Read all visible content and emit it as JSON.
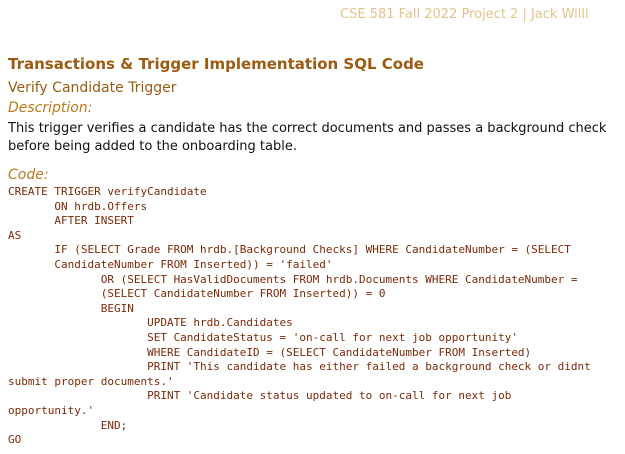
{
  "header": {
    "running_title": "CSE 581 Fall 2022 Project 2 | Jack Willi"
  },
  "section": {
    "title": "Transactions & Trigger Implementation SQL Code"
  },
  "subsection": {
    "title": "Verify Candidate Trigger"
  },
  "description": {
    "label": "Description:",
    "text": "This trigger verifies a candidate has the correct documents and passes a background check before being added to the onboarding table."
  },
  "code": {
    "label": "Code:",
    "lines": [
      "CREATE TRIGGER verifyCandidate",
      "       ON hrdb.Offers",
      "       AFTER INSERT",
      "AS",
      "       IF (SELECT Grade FROM hrdb.[Background Checks] WHERE CandidateNumber = (SELECT",
      "       CandidateNumber FROM Inserted)) = 'failed'",
      "              OR (SELECT HasValidDocuments FROM hrdb.Documents WHERE CandidateNumber =",
      "              (SELECT CandidateNumber FROM Inserted)) = 0",
      "              BEGIN",
      "                     UPDATE hrdb.Candidates",
      "                     SET CandidateStatus = 'on-call for next job opportunity'",
      "                     WHERE CandidateID = (SELECT CandidateNumber FROM Inserted)",
      "                     PRINT 'This candidate has either failed a background check or didnt",
      "submit proper documents.'",
      "                     PRINT 'Candidate status updated to on-call for next job",
      "opportunity.'",
      "              END;",
      "GO"
    ]
  }
}
